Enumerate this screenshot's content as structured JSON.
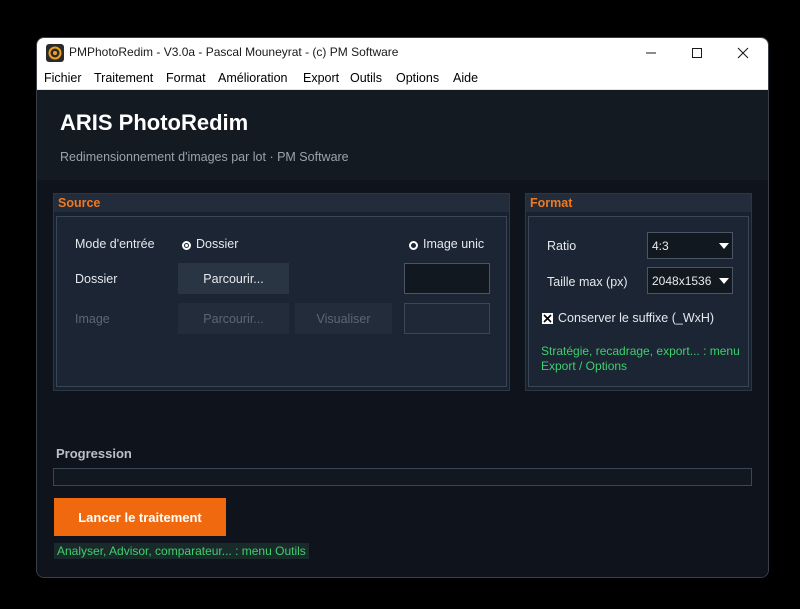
{
  "window": {
    "title": "PMPhotoRedim - V3.0a - Pascal Mouneyrat - (c) PM Software"
  },
  "menu": [
    "Fichier",
    "Traitement",
    "Format",
    "Amélioration",
    "Export",
    "Outils",
    "Options",
    "Aide"
  ],
  "header": {
    "title": "ARIS PhotoRedim",
    "subtitle": "Redimensionnement d'images par lot  ·  PM Software"
  },
  "source": {
    "heading": "Source",
    "mode_label": "Mode d'entrée",
    "radio_dossier": "Dossier",
    "radio_image": "Image unic",
    "dossier_label": "Dossier",
    "browse_label": "Parcourir...",
    "image_label": "Image",
    "image_browse_label": "Parcourir...",
    "visualiser_label": "Visualiser"
  },
  "format": {
    "heading": "Format",
    "ratio_label": "Ratio",
    "ratio_value": "4:3",
    "taille_label": "Taille max (px)",
    "taille_value": "2048x1536",
    "suffix_label": "Conserver le suffixe (_WxH)",
    "suffix_checked": true,
    "note_line1": "Stratégie, recadrage, export... : menu",
    "note_line2": "Export / Options"
  },
  "progress": {
    "label": "Progression",
    "value": 0
  },
  "actions": {
    "run_label": "Lancer le traitement",
    "tools_note": "Analyser, Advisor, comparateur... : menu Outils"
  },
  "colors": {
    "accent": "#f07820",
    "note_green": "#3ecf6e"
  }
}
